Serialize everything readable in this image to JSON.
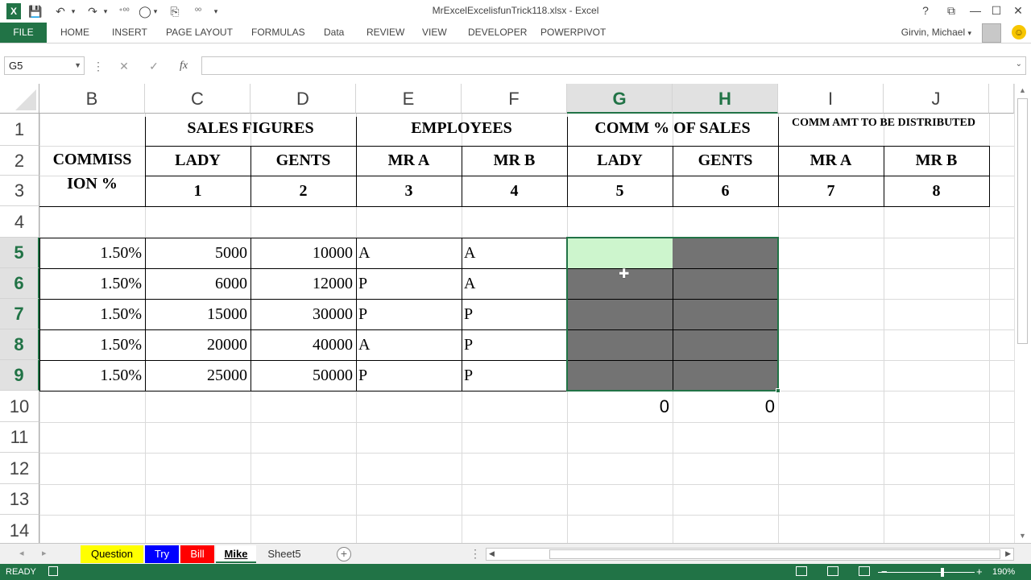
{
  "window": {
    "title": "MrExcelExcelisfunTrick118.xlsx - Excel",
    "help": "?",
    "restore": "⧉",
    "minimize": "—",
    "maximize": "☐",
    "close": "✕"
  },
  "quick_access": {
    "app_icon": "X",
    "save": "💾",
    "undo": "↶",
    "redo": "↷",
    "more": "▾"
  },
  "ribbon": {
    "file": "FILE",
    "tabs": [
      "HOME",
      "INSERT",
      "PAGE LAYOUT",
      "FORMULAS",
      "Data",
      "REVIEW",
      "VIEW",
      "DEVELOPER",
      "POWERPIVOT"
    ],
    "user": "Girvin, Michael",
    "user_dropdown": "▾",
    "smiley": "☺"
  },
  "formula_bar": {
    "name_box": "G5",
    "cancel": "✕",
    "enter": "✓",
    "fx": "fx",
    "content": ""
  },
  "columns": [
    "B",
    "C",
    "D",
    "E",
    "F",
    "G",
    "H",
    "I",
    "J"
  ],
  "rows": [
    "1",
    "2",
    "3",
    "4",
    "5",
    "6",
    "7",
    "8",
    "9",
    "10",
    "11",
    "12",
    "13",
    "14"
  ],
  "sheet": {
    "sales_figures": "SALES FIGURES",
    "employees": "EMPLOYEES",
    "comm_pct_sales": "COMM % OF SALES",
    "comm_amt": "COMM AMT TO BE DISTRIBUTED",
    "commission_line1": "COMMISS",
    "commission_line2": "ION %",
    "header_row2": [
      "LADY",
      "GENTS",
      "MR A",
      "MR B",
      "LADY",
      "GENTS",
      "MR A",
      "MR B"
    ],
    "header_row3": [
      "1",
      "2",
      "3",
      "4",
      "5",
      "6",
      "7",
      "8"
    ],
    "data_rows": [
      {
        "pct": "1.50%",
        "lady": "5000",
        "gents": "10000",
        "mra": "A",
        "mrb": "A"
      },
      {
        "pct": "1.50%",
        "lady": "6000",
        "gents": "12000",
        "mra": "P",
        "mrb": "A"
      },
      {
        "pct": "1.50%",
        "lady": "15000",
        "gents": "30000",
        "mra": "P",
        "mrb": "P"
      },
      {
        "pct": "1.50%",
        "lady": "20000",
        "gents": "40000",
        "mra": "A",
        "mrb": "P"
      },
      {
        "pct": "1.50%",
        "lady": "25000",
        "gents": "50000",
        "mra": "P",
        "mrb": "P"
      }
    ],
    "totals": {
      "g": "0",
      "h": "0"
    }
  },
  "sheet_tabs": {
    "tabs": [
      {
        "name": "Question",
        "color": "#ffff00",
        "text_color": "#000000"
      },
      {
        "name": "Try",
        "color": "#0000ff",
        "text_color": "#ffffff"
      },
      {
        "name": "Bill",
        "color": "#ff0000",
        "text_color": "#ffffff"
      },
      {
        "name": "Mike",
        "color": "#ffffff",
        "text_color": "#000000"
      },
      {
        "name": "Sheet5",
        "color": "#f0f0f0",
        "text_color": "#333333"
      }
    ],
    "active": "Mike",
    "new_sheet": "+",
    "nav_prev": "◂",
    "nav_next": "▸",
    "more": "⋮"
  },
  "status_bar": {
    "ready": "READY",
    "zoom_out": "−",
    "zoom_in": "+",
    "zoom": "190%"
  },
  "colors": {
    "excel_green": "#217346",
    "active_cell_fill": "#cdf5cd",
    "selection_fill": "#737373"
  }
}
